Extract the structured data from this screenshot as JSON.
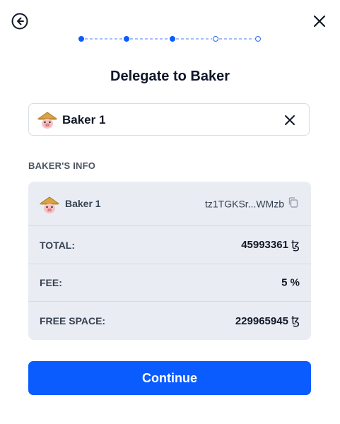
{
  "header": {
    "title": "Delegate to Baker",
    "back_icon": "arrow-left-circle-icon",
    "close_icon": "close-icon"
  },
  "stepper": {
    "total_steps": 5,
    "completed_steps": 3,
    "active_color": "#0b5cff",
    "inactive_color": "#4a7df0"
  },
  "baker_select": {
    "selected": "Baker 1",
    "avatar_icon": "baker-avatar-icon",
    "clear_icon": "close-icon"
  },
  "bakers_info": {
    "section_label": "BAKER'S INFO",
    "baker_name": "Baker 1",
    "address": "tz1TGKSr...WMzb",
    "copy_icon": "copy-icon",
    "rows": {
      "total": {
        "label": "TOTAL:",
        "value": "45993361",
        "unit": "ꜩ"
      },
      "fee": {
        "label": "FEE:",
        "value": "5 %"
      },
      "free_space": {
        "label": "FREE SPACE:",
        "value": "229965945",
        "unit": "ꜩ"
      }
    }
  },
  "actions": {
    "continue_label": "Continue"
  },
  "colors": {
    "primary": "#0b5cff",
    "card_bg": "#e9edf3"
  }
}
